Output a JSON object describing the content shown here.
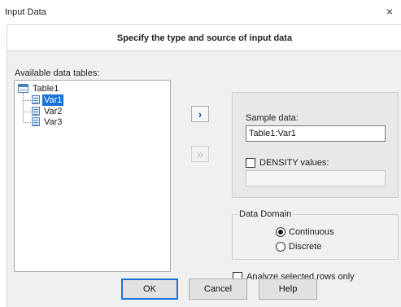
{
  "window": {
    "title": "Input Data",
    "close_glyph": "×"
  },
  "header": {
    "heading": "Specify the type and source of input data"
  },
  "data_tables": {
    "label": "Available data tables:",
    "table": {
      "name": "Table1",
      "icon": "table-icon"
    },
    "variables": [
      {
        "name": "Var1",
        "icon": "variable-icon",
        "selected": true
      },
      {
        "name": "Var2",
        "icon": "variable-icon",
        "selected": false
      },
      {
        "name": "Var3",
        "icon": "variable-icon",
        "selected": false
      }
    ]
  },
  "arrows": {
    "add_sample": {
      "icon": "chevron-right-icon",
      "glyph": "›",
      "enabled": true
    },
    "add_density": {
      "icon": "double-chevron-right-icon",
      "glyph": "»",
      "enabled": false
    }
  },
  "sample": {
    "label": "Sample data:",
    "value": "Table1:Var1",
    "density_label": "DENSITY values:",
    "density_checked": false,
    "density_value": ""
  },
  "data_domain": {
    "legend": "Data Domain",
    "options": [
      {
        "label": "Continuous",
        "checked": true
      },
      {
        "label": "Discrete",
        "checked": false
      }
    ]
  },
  "analyze_selected": {
    "label": "Analyze selected rows only",
    "checked": false
  },
  "buttons": {
    "ok": "OK",
    "cancel": "Cancel",
    "help": "Help"
  },
  "colors": {
    "selection": "#1a73d9",
    "arrow": "#1f5fb0",
    "dialog_bg": "#f0f0f0"
  }
}
